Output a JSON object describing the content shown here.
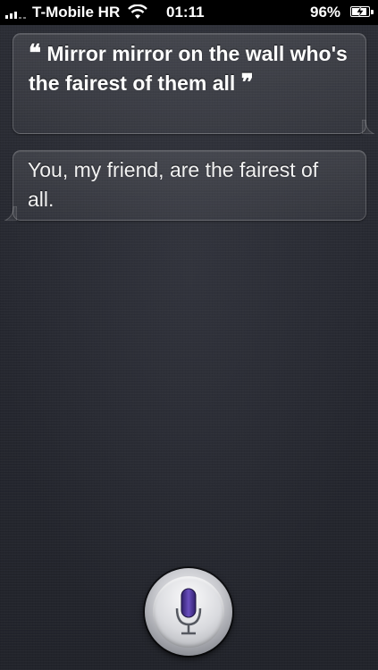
{
  "status_bar": {
    "carrier": "T-Mobile HR",
    "time": "01:11",
    "battery_percent": "96%",
    "battery_level": 0.96,
    "wifi_icon": "wifi-icon",
    "signal_icon": "signal-bars-icon",
    "battery_icon": "battery-charging-icon"
  },
  "conversation": {
    "user_query": "Mirror mirror on the wall who's the fairest of them all",
    "open_quote": "❝",
    "close_quote": "❞",
    "siri_response": "You, my friend, are the fairest of all."
  },
  "mic": {
    "icon": "microphone-icon",
    "accent_color": "#5b3fa0"
  }
}
